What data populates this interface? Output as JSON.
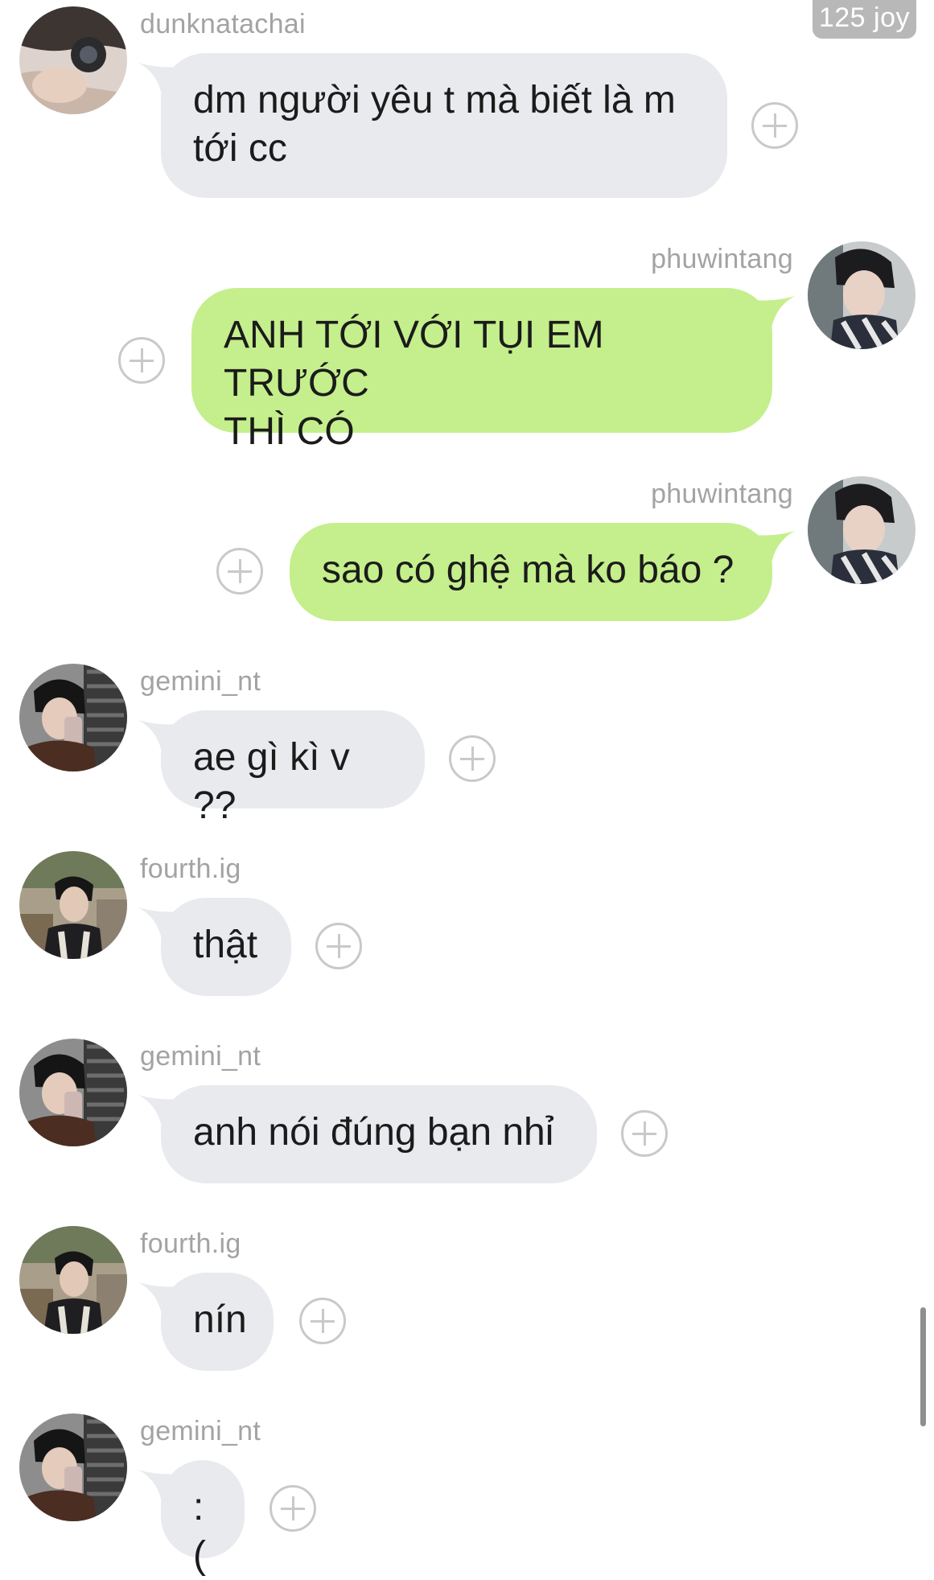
{
  "watermark": "125 joy",
  "messages": [
    {
      "user": "dunknatachai",
      "text": "dm người yêu t mà biết là m\ntới cc",
      "side": "in",
      "avatar_icon": "dunknatachai-avatar"
    },
    {
      "user": "phuwintang",
      "text": "ANH TỚI VỚI TỤI EM TRƯỚC\nTHÌ CÓ",
      "side": "out",
      "avatar_icon": "phuwintang-avatar"
    },
    {
      "user": "phuwintang",
      "text": "sao có ghệ mà ko báo ?",
      "side": "out",
      "avatar_icon": "phuwintang-avatar"
    },
    {
      "user": "gemini_nt",
      "text": "ae gì kì v ??",
      "side": "in",
      "avatar_icon": "gemini-nt-avatar"
    },
    {
      "user": "fourth.ig",
      "text": "thật",
      "side": "in",
      "avatar_icon": "fourth-ig-avatar"
    },
    {
      "user": "gemini_nt",
      "text": "anh nói đúng bạn nhỉ",
      "side": "in",
      "avatar_icon": "gemini-nt-avatar"
    },
    {
      "user": "fourth.ig",
      "text": "nín",
      "side": "in",
      "avatar_icon": "fourth-ig-avatar"
    },
    {
      "user": "gemini_nt",
      "text": ":(",
      "side": "in",
      "avatar_icon": "gemini-nt-avatar"
    }
  ],
  "react_icon": "add-reaction-icon",
  "colors": {
    "incoming_bubble": "#e8eaee",
    "outgoing_bubble": "#c4ef8c",
    "username": "#a3a3a3",
    "reaction_button": "#c9c9c9"
  }
}
